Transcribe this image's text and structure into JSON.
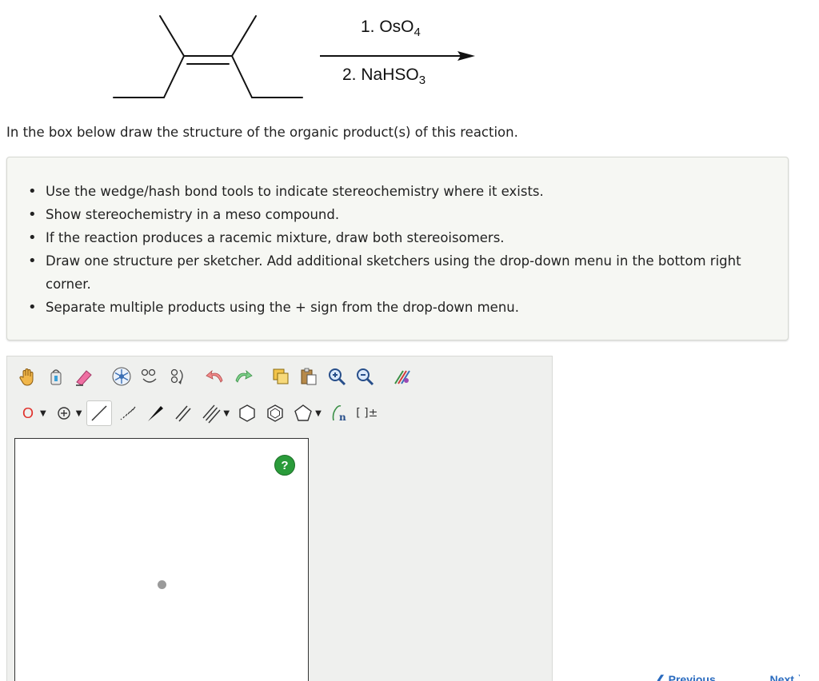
{
  "reaction": {
    "reagent1_prefix": "1. OsO",
    "reagent1_sub": "4",
    "reagent2_prefix": "2. NaHSO",
    "reagent2_sub": "3"
  },
  "instruction": "In the box below draw the structure of the organic product(s) of this reaction.",
  "hints": [
    "Use the wedge/hash bond tools to indicate stereochemistry where it exists.",
    "Show stereochemistry in a meso compound.",
    "If the reaction produces a racemic mixture, draw both stereoisomers.",
    "Draw one structure per sketcher. Add additional sketchers using the drop-down menu in the bottom right corner.",
    "Separate multiple products using the + sign from the drop-down menu."
  ],
  "sketcher": {
    "atom_label": "O",
    "help_label": "?",
    "charge_label": "[ ]±",
    "sgroup_label": "n"
  },
  "nav": {
    "previous_label": "Previous",
    "next_label": "Next"
  },
  "colors": {
    "atom_red": "#e0302a",
    "help_green": "#2a9b3a",
    "arrow_black": "#111111"
  }
}
